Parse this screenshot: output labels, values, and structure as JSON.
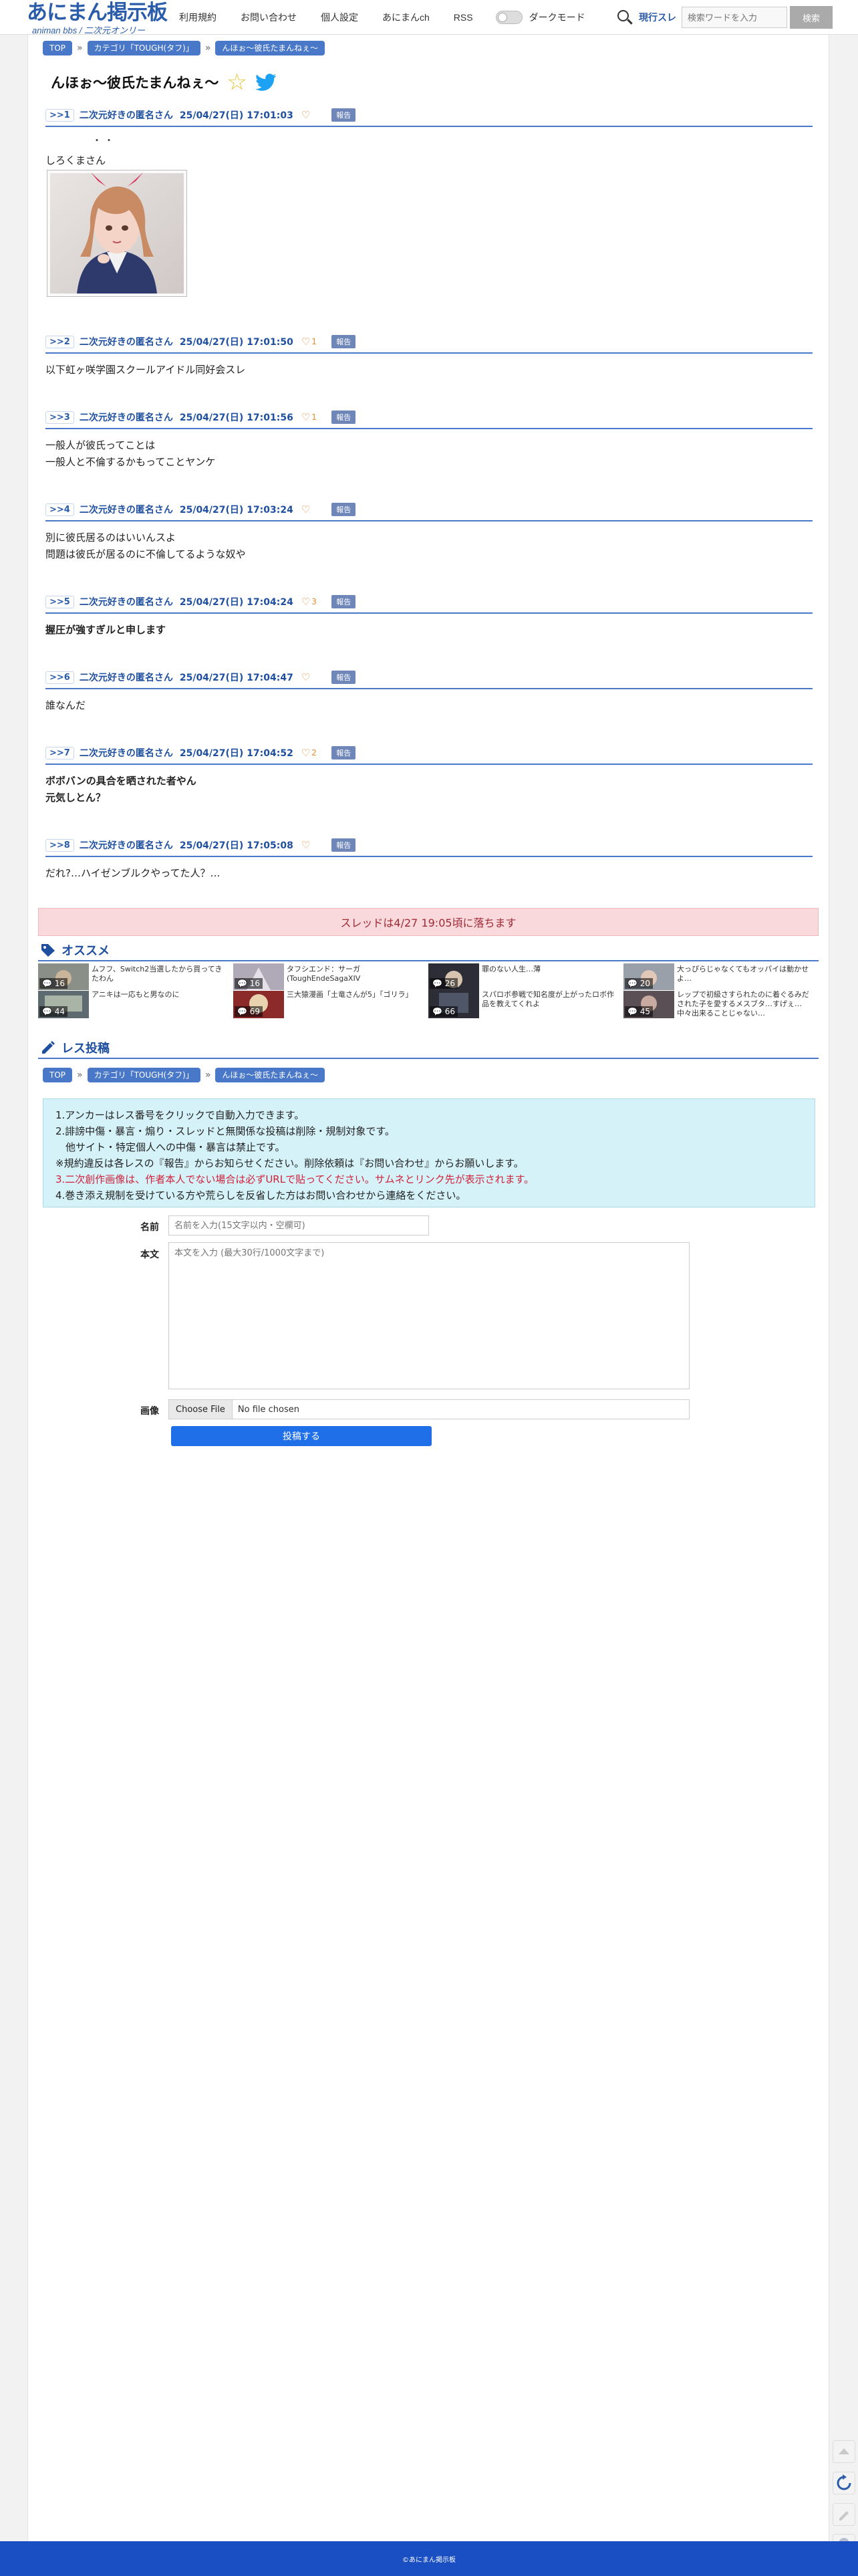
{
  "header": {
    "logo_title": "あにまん掲示板",
    "logo_sub": "animan bbs / 二次元オンリー",
    "nav": [
      "利用規約",
      "お問い合わせ",
      "個人設定",
      "あにまんch",
      "RSS"
    ],
    "darkmode_label": "ダークモード",
    "search_scope": "現行スレ",
    "search_placeholder": "検索ワードを入力",
    "search_button": "検索"
  },
  "breadcrumb": {
    "top": "TOP",
    "category": "カテゴリ「TOUGH(タフ)」",
    "thread": "んほぉ〜彼氏たまんねぇ〜"
  },
  "thread_title": "んほぉ〜彼氏たまんねぇ〜",
  "report_label": "報告",
  "posts": [
    {
      "num": "1",
      "name": "二次元好きの匿名さん",
      "date": "25/04/27(日) 17:01:03",
      "likes": "",
      "lines": [
        "しろくまさん"
      ]
    },
    {
      "num": "2",
      "name": "二次元好きの匿名さん",
      "date": "25/04/27(日) 17:01:50",
      "likes": "1",
      "lines": [
        "以下虹ヶ咲学園スクールアイドル同好会スレ"
      ]
    },
    {
      "num": "3",
      "name": "二次元好きの匿名さん",
      "date": "25/04/27(日) 17:01:56",
      "likes": "1",
      "lines": [
        "一般人が彼氏ってことは",
        "一般人と不倫するかもってことヤンケ"
      ]
    },
    {
      "num": "4",
      "name": "二次元好きの匿名さん",
      "date": "25/04/27(日) 17:03:24",
      "likes": "",
      "lines": [
        "別に彼氏居るのはいいんスよ",
        "問題は彼氏が居るのに不倫してるような奴や"
      ]
    },
    {
      "num": "5",
      "name": "二次元好きの匿名さん",
      "date": "25/04/27(日) 17:04:24",
      "likes": "3",
      "lines": [
        "握圧が強すぎルと申します"
      ]
    },
    {
      "num": "6",
      "name": "二次元好きの匿名さん",
      "date": "25/04/27(日) 17:04:47",
      "likes": "",
      "lines": [
        "誰なんだ"
      ]
    },
    {
      "num": "7",
      "name": "二次元好きの匿名さん",
      "date": "25/04/27(日) 17:04:52",
      "likes": "2",
      "lines": [
        "ボボバンの具合を晒された者やん",
        "元気しとん？"
      ]
    },
    {
      "num": "8",
      "name": "二次元好きの匿名さん",
      "date": "25/04/27(日) 17:05:08",
      "likes": "",
      "lines": [
        "だれ?…ハイゼンブルクやってた人？…"
      ]
    }
  ],
  "post1_dots": "・・",
  "expire_notice": "スレッドは4/27 19:05頃に落ちます",
  "recommend": {
    "heading": "オススメ",
    "items": [
      {
        "count": "16",
        "t1": "ムフフ、Switch2当選したから買ってきたわん",
        "c2": "44",
        "t2": "アニキは一応もと男なのに"
      },
      {
        "count": "16",
        "t1": "タフシエンド：サーガ(ToughEndeSagaXIV",
        "c2": "69",
        "t2": "三大猿漫画「土竜さんが5」「ゴリラ」"
      },
      {
        "count": "26",
        "t1": "罪のない人生…薄",
        "c2": "66",
        "t2": "スパロボ参戦で知名度が上がったロボ作品を教えてくれよ"
      },
      {
        "count": "20",
        "t1": "大っぴらじゃなくてもオッパイは動かせよ…",
        "c2": "45",
        "t2": "レップで初級さすられたのに着ぐるみだされた子を愛するメスブタ…すげぇ…中々出来ることじゃない…"
      }
    ]
  },
  "form": {
    "heading": "レス投稿",
    "rules": [
      "1.アンカーはレス番号をクリックで自動入力できます。",
      "2.誹謗中傷・暴言・煽り・スレッドと無関係な投稿は削除・規制対象です。",
      "　他サイト・特定個人への中傷・暴言は禁止です。",
      "※規約違反は各レスの『報告』からお知らせください。削除依頼は『お問い合わせ』からお願いします。",
      "3.二次創作画像は、作者本人でない場合は必ずURLで貼ってください。サムネとリンク先が表示されます。",
      "4.巻き添え規制を受けている方や荒らしを反省した方はお問い合わせから連絡をください。"
    ],
    "name_label": "名前",
    "name_placeholder": "名前を入力(15文字以内・空欄可)",
    "body_label": "本文",
    "body_placeholder": "本文を入力 (最大30行/1000文字まで)",
    "image_label": "画像",
    "file_button": "Choose File",
    "file_status": "No file chosen",
    "submit": "投稿する"
  },
  "footer": "©あにまん掲示板",
  "colors": {
    "accent": "#4a78c9",
    "footer": "#1a4fc4",
    "alert_bg": "#f9d9dc",
    "rules_bg": "#d5f2f8"
  }
}
